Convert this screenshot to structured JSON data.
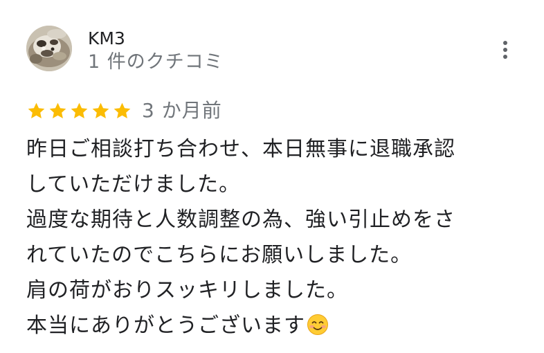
{
  "reviewer": {
    "name": "KM3",
    "meta": "1 件のクチコミ"
  },
  "rating": {
    "stars": 5,
    "max_stars": 5,
    "date": "3 か月前"
  },
  "review": {
    "lines": [
      "昨日ご相談打ち合わせ、本日無事に退職承認",
      "していただけました。",
      "過度な期待と人数調整の為、強い引止めをさ",
      "れていたのでこちらにお願いしました。",
      "肩の荷がおりスッキリしました。",
      "本当にありがとうございます"
    ],
    "trailing_emoji": "smiling-face-emoji"
  },
  "icons": {
    "more": "more-vert-icon",
    "star": "star-icon",
    "avatar": "avatar-photo"
  },
  "colors": {
    "star": "#fbbc04",
    "text_primary": "#202124",
    "text_secondary": "#70757a",
    "icon": "#5f6368"
  }
}
